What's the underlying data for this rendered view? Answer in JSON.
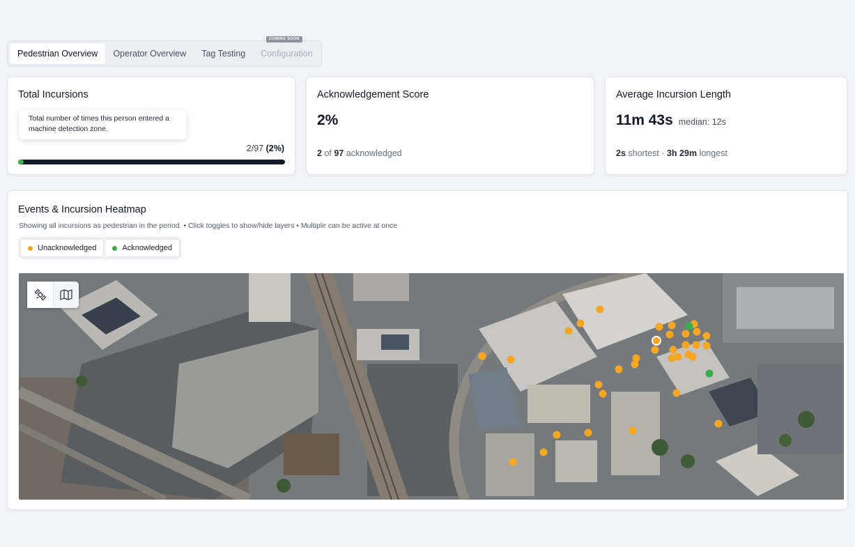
{
  "tabs": [
    {
      "label": "Pedestrian Overview",
      "state": "active"
    },
    {
      "label": "Operator Overview",
      "state": "normal"
    },
    {
      "label": "Tag Testing",
      "state": "normal"
    },
    {
      "label": "Configuration",
      "state": "disabled",
      "badge": "COMING SOON"
    }
  ],
  "total_incursions": {
    "title": "Total Incursions",
    "tooltip": "Total number of times this person entered a machine detection zone.",
    "ratio_text": "2/97",
    "ratio_pct": "(2%)",
    "progress_fraction": 0.02
  },
  "ack_score": {
    "title": "Acknowledgement Score",
    "value": "2%",
    "ack_count": "2",
    "of_label": "of",
    "total": "97",
    "suffix": "acknowledged"
  },
  "avg_length": {
    "title": "Average Incursion Length",
    "value": "11m 43s",
    "median": "median: 12s",
    "shortest": "2s",
    "shortest_label": "shortest ·",
    "longest": "3h 29m",
    "longest_label": "longest"
  },
  "heatmap": {
    "title": "Events & Incursion Heatmap",
    "description": "Showing all incursions as pedestrian in the period.  •  Click toggles to show/hide layers • Multiple can be active at once",
    "layers": [
      {
        "label": "Unacknowledged",
        "color": "#f5a623"
      },
      {
        "label": "Acknowledged",
        "color": "#35b04a"
      }
    ],
    "map_controls": [
      "satellite-icon",
      "map-icon"
    ]
  },
  "colors": {
    "unacknowledged": "#f5a623",
    "acknowledged": "#35b04a",
    "progress_track": "#141a2a"
  }
}
